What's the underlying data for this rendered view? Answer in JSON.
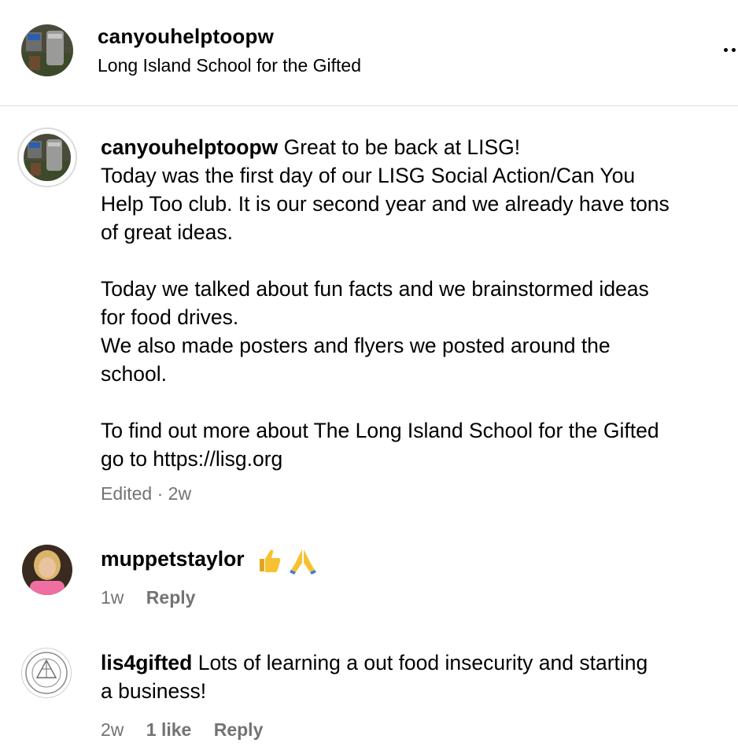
{
  "header": {
    "username": "canyouhelptoopw",
    "location": "Long Island School for the Gifted"
  },
  "caption": {
    "username": "canyouhelptoopw",
    "lines": [
      "Great to be back at LISG!",
      "Today was the first day of our LISG Social Action/Can You",
      "Help Too club. It is our second year and we already have tons",
      "of great ideas.",
      "",
      "Today we talked about fun facts and we brainstormed ideas",
      "for food drives.",
      "We also made posters and flyers we posted around the",
      "school.",
      "",
      "To find out more about The Long Island School for the Gifted",
      "go to https://lisg.org"
    ],
    "meta": "Edited · 2w"
  },
  "comments": [
    {
      "username": "muppetstaylor",
      "text": "",
      "emojis": [
        "thumbs-up-emoji",
        "folded-hands-emoji"
      ],
      "time": "1w",
      "likes": "",
      "reply": "Reply"
    },
    {
      "username": "lis4gifted",
      "text": "Lots of learning a out food insecurity and starting",
      "text_line2": "a business!",
      "time": "2w",
      "likes": "1 like",
      "reply": "Reply"
    }
  ],
  "colors": {
    "text": "#000000",
    "secondary": "#737373",
    "divider": "#dbdbdb",
    "emoji_yellow": "#f6c231",
    "avatar_pink": "#ef6fa3"
  }
}
